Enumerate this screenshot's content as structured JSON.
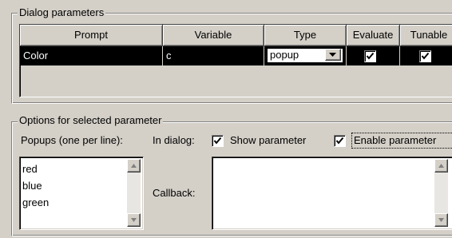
{
  "dialog_parameters": {
    "legend": "Dialog parameters",
    "columns": [
      "Prompt",
      "Variable",
      "Type",
      "Evaluate",
      "Tunable"
    ],
    "row": {
      "prompt": "Color",
      "variable": "c",
      "type": "popup",
      "evaluate_checked": true,
      "tunable_checked": true
    }
  },
  "options": {
    "legend": "Options for selected parameter",
    "popups_label": "Popups (one per line):",
    "popups_lines": [
      "red",
      "blue",
      "green"
    ],
    "in_dialog_label": "In dialog:",
    "show_parameter_label": "Show parameter",
    "show_parameter_checked": true,
    "enable_parameter_label": "Enable parameter",
    "enable_parameter_checked": true,
    "callback_label": "Callback:",
    "callback_value": ""
  }
}
